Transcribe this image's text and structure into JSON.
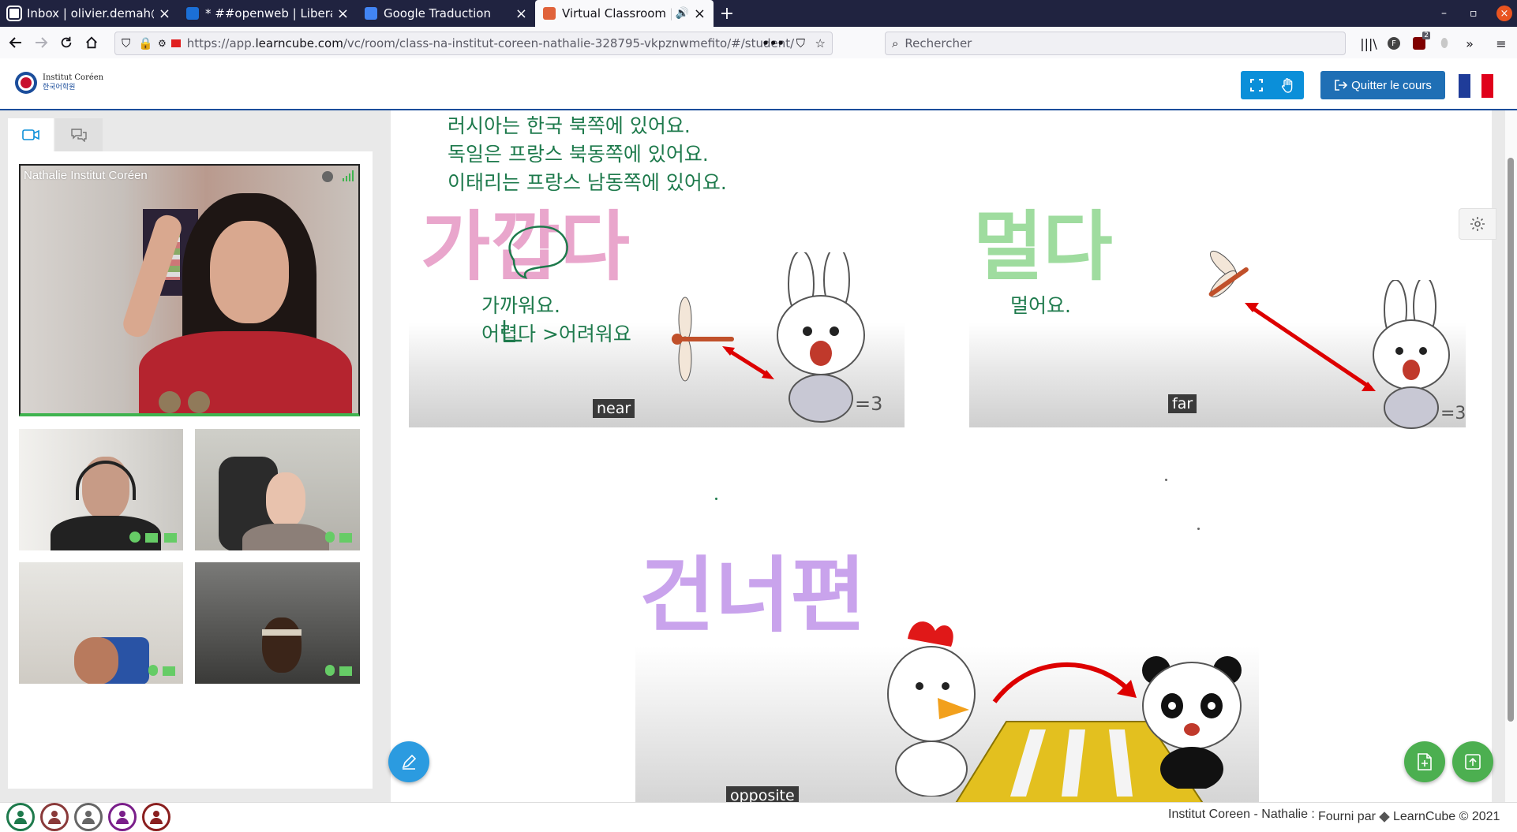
{
  "browser": {
    "tabs": [
      {
        "title": "Inbox | olivier.demah@proton.me",
        "favicon_color": "#444"
      },
      {
        "title": "* ##openweb | Libera.Chat",
        "favicon_color": "#1b6fd6"
      },
      {
        "title": "Google Traduction",
        "favicon_color": "#4285f4"
      },
      {
        "title": "Virtual Classroom | LearnCube",
        "favicon_color": "#e0623a"
      }
    ],
    "url_prefix": "https://app.",
    "url_domain": "learncube.com",
    "url_path": "/vc/room/class-na-institut-coreen-nathalie-328795-vkpznwmefito/#/student/",
    "search_placeholder": "Rechercher",
    "pocket_badge": "2"
  },
  "header": {
    "logo_title": "Institut Coréen",
    "logo_sub": "한국어학원",
    "quit_label": "Quitter le cours"
  },
  "sidebar": {
    "main_video_label": "Nathalie Institut Coréen"
  },
  "board": {
    "sentences": [
      "러시아는 한국 북쪽에 있어요.",
      "독일은 프랑스 북동쪽에 있어요.",
      "이태리는 프랑스 남동쪽에 있어요."
    ],
    "word_near": "가깝다",
    "near_lines": [
      "가까워요.",
      "어렵다 >어려워요"
    ],
    "near_caption": "near",
    "word_far": "멀다",
    "far_line": "멀어요.",
    "far_caption": "far",
    "word_opposite": "건너편",
    "opposite_caption": "opposite"
  },
  "footer": {
    "room_text": "Institut Coreen - Nathalie :",
    "powered_text": "Fourni par",
    "brand_text": "LearnCube © 2021"
  },
  "colors": {
    "accent_blue": "#0b8fd9",
    "quit_blue": "#1f6fb5",
    "green_fab": "#4caf50",
    "korean_text": "#1e7a4c"
  }
}
